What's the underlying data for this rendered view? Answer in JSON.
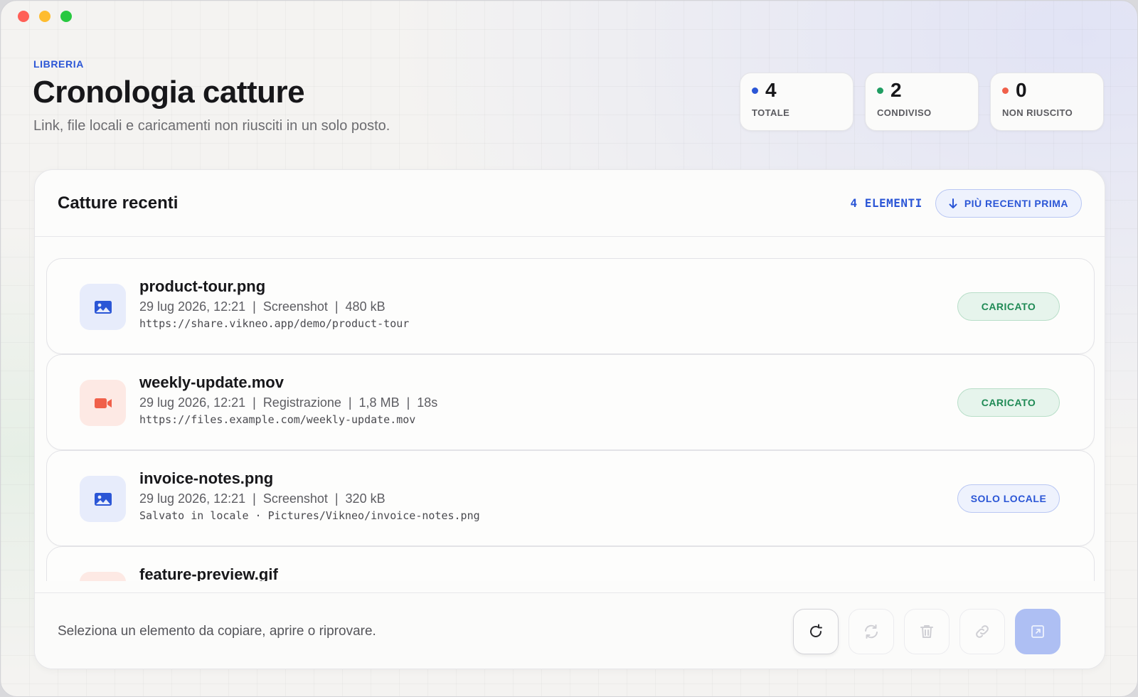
{
  "header": {
    "eyebrow": "LIBRERIA",
    "title": "Cronologia catture",
    "subtitle": "Link, file locali e caricamenti non riusciti in un solo posto."
  },
  "stats": [
    {
      "value": "4",
      "label": "TOTALE",
      "dot_color": "#2b56d6"
    },
    {
      "value": "2",
      "label": "CONDIVISO",
      "dot_color": "#1f9d62"
    },
    {
      "value": "0",
      "label": "NON RIUSCITO",
      "dot_color": "#f0604a"
    }
  ],
  "panel": {
    "title": "Catture recenti",
    "count_label": "4 ELEMENTI",
    "sort_label": "PIÙ RECENTI PRIMA"
  },
  "items": [
    {
      "name": "product-tour.png",
      "meta": "29 lug 2026, 12:21  |  Screenshot  |  480 kB",
      "url": "https://share.vikneo.app/demo/product-tour",
      "status": "CARICATO",
      "icon": "image-icon"
    },
    {
      "name": "weekly-update.mov",
      "meta": "29 lug 2026, 12:21  |  Registrazione  |  1,8 MB  |  18s",
      "url": "https://files.example.com/weekly-update.mov",
      "status": "CARICATO",
      "icon": "video-icon"
    },
    {
      "name": "invoice-notes.png",
      "meta": "29 lug 2026, 12:21  |  Screenshot  |  320 kB",
      "url": "Salvato in locale · Pictures/Vikneo/invoice-notes.png",
      "status": "SOLO LOCALE",
      "icon": "image-icon"
    },
    {
      "name": "feature-preview.gif",
      "icon": "video-icon"
    }
  ],
  "footer": {
    "hint": "Seleziona un elemento da copiare, aprire o riprovare."
  },
  "colors": {
    "accent": "#2b56d6",
    "success": "#1f8a55",
    "video": "#f0604a"
  }
}
